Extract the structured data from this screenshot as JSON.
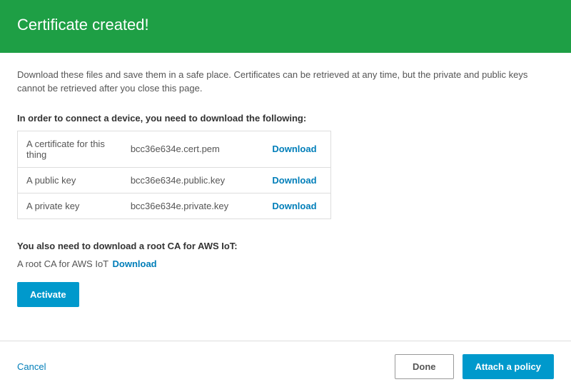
{
  "header": {
    "title": "Certificate created!"
  },
  "intro": "Download these files and save them in a safe place. Certificates can be retrieved at any time, but the private and public keys cannot be retrieved after you close this page.",
  "downloads": {
    "heading": "In order to connect a device, you need to download the following:",
    "rows": [
      {
        "label": "A certificate for this thing",
        "filename": "bcc36e634e.cert.pem",
        "action": "Download"
      },
      {
        "label": "A public key",
        "filename": "bcc36e634e.public.key",
        "action": "Download"
      },
      {
        "label": "A private key",
        "filename": "bcc36e634e.private.key",
        "action": "Download"
      }
    ]
  },
  "root_ca": {
    "heading": "You also need to download a root CA for AWS IoT:",
    "label": "A root CA for AWS IoT",
    "action": "Download"
  },
  "buttons": {
    "activate": "Activate",
    "cancel": "Cancel",
    "done": "Done",
    "attach_policy": "Attach a policy"
  }
}
